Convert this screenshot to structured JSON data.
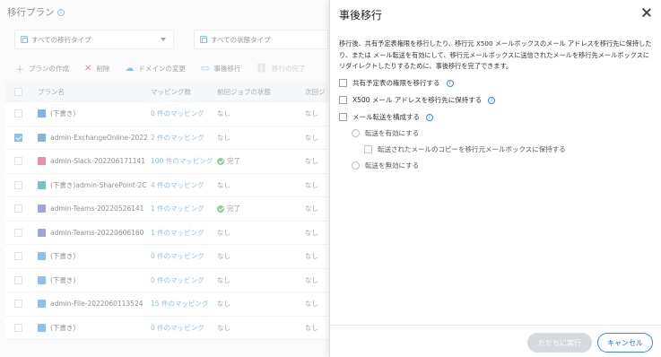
{
  "page": {
    "title": "移行プラン",
    "filters": [
      "すべての移行タイプ",
      "すべての状態タイプ"
    ],
    "toolbar": [
      {
        "label": "プランの作成",
        "icon": "plus-icon"
      },
      {
        "label": "削除",
        "icon": "x-icon"
      },
      {
        "label": "ドメインの変更",
        "icon": "cloud-icon"
      },
      {
        "label": "事後移行",
        "icon": "screen-icon"
      },
      {
        "label": "移行の完了",
        "icon": "link-icon"
      }
    ],
    "columns": [
      "プラン名",
      "マッピング数",
      "前回ジョブの状態",
      "次回ジ"
    ],
    "rows": [
      {
        "name": "(下書き)",
        "icon_color": "#2a6fc9",
        "mapping": "0 件のマッピング",
        "last": "なし",
        "next": "なし",
        "checked": false,
        "ok": false
      },
      {
        "name": "admin-ExchangeOnline-2022",
        "icon_color": "#2a6fc9",
        "mapping": "2 件のマッピング",
        "last": "なし",
        "next": "なし",
        "checked": true,
        "ok": false
      },
      {
        "name": "admin-Slack-202206171141",
        "icon_color": "#d9325d",
        "mapping": "100 件のマッピング",
        "last": "完了",
        "next": "なし",
        "checked": false,
        "ok": true
      },
      {
        "name": "(下書き)admin-SharePoint-2C",
        "icon_color": "#1b8a8a",
        "mapping": "4 件のマッピング",
        "last": "なし",
        "next": "なし",
        "checked": false,
        "ok": false
      },
      {
        "name": "admin-Teams-20220526141",
        "icon_color": "#5059c9",
        "mapping": "1 件のマッピング",
        "last": "完了",
        "next": "なし",
        "checked": false,
        "ok": true
      },
      {
        "name": "admin-Teams-20220606160",
        "icon_color": "#5059c9",
        "mapping": "1 件のマッピング",
        "last": "なし",
        "next": "なし",
        "checked": false,
        "ok": false
      },
      {
        "name": "(下書き)",
        "icon_color": "#3a8bd8",
        "mapping": "0 件のマッピング",
        "last": "なし",
        "next": "なし",
        "checked": false,
        "ok": false
      },
      {
        "name": "(下書き)",
        "icon_color": "#3a8bd8",
        "mapping": "0 件のマッピング",
        "last": "なし",
        "next": "なし",
        "checked": false,
        "ok": false
      },
      {
        "name": "admin-File-2022060113524",
        "icon_color": "#3a8bd8",
        "mapping": "15 件のマッピング",
        "last": "なし",
        "next": "なし",
        "checked": false,
        "ok": false
      },
      {
        "name": "(下書き)",
        "icon_color": "#3a8bd8",
        "mapping": "0 件のマッピング",
        "last": "なし",
        "next": "なし",
        "checked": false,
        "ok": false
      }
    ]
  },
  "panel": {
    "title": "事後移行",
    "description": "移行後、共有予定表権限を移行したり、移行元 X500 メールボックスのメール アドレスを移行先に保持したり、または メール転送を有効にして、移行元メールボックスに送信されたメールを移行先メールボックスにリダイレクトしたりするために、事後移行を完了できます。",
    "options": {
      "calendar": "共有予定表の権限を移行する",
      "x500": "X500 メール アドレスを移行先に保持する",
      "forwarding": "メール転送を構成する",
      "enable": "転送を有効にする",
      "keep_copy": "転送されたメールのコピーを移行元メールボックスに保持する",
      "disable": "転送を無効にする"
    },
    "buttons": {
      "run": "ただちに実行",
      "cancel": "キャンセル"
    }
  },
  "colors": {
    "accent": "#3a8bd8",
    "success": "#2fa84f",
    "disabled_button": "#d6d9de"
  }
}
